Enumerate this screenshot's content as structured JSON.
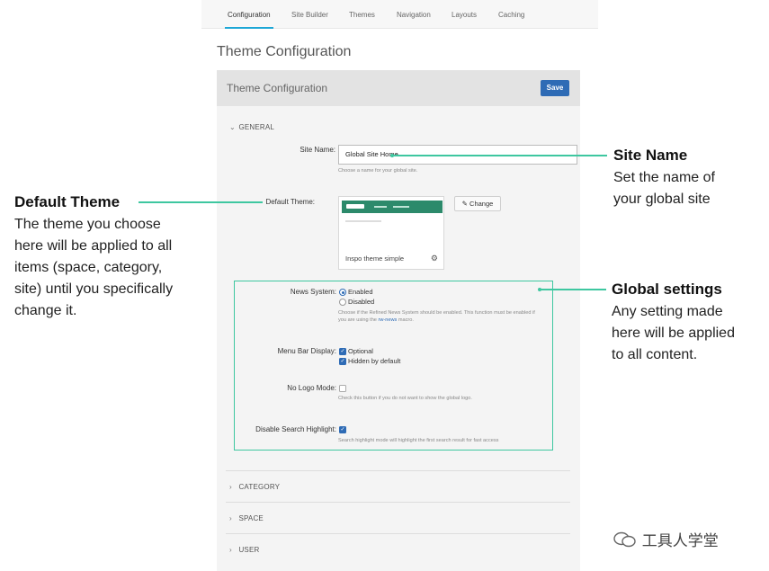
{
  "tabs": [
    {
      "label": "Configuration",
      "active": true
    },
    {
      "label": "Site Builder",
      "active": false
    },
    {
      "label": "Themes",
      "active": false
    },
    {
      "label": "Navigation",
      "active": false
    },
    {
      "label": "Layouts",
      "active": false
    },
    {
      "label": "Caching",
      "active": false
    }
  ],
  "page_title": "Theme Configuration",
  "panel": {
    "title": "Theme Configuration",
    "save_label": "Save"
  },
  "sections": {
    "general": "GENERAL",
    "category": "CATEGORY",
    "space": "SPACE",
    "user": "USER"
  },
  "site_name": {
    "label": "Site Name:",
    "value": "Global Site Home",
    "help": "Choose a name for your global site."
  },
  "default_theme": {
    "label": "Default Theme:",
    "theme_name": "Inspo theme simple",
    "change_label": "Change"
  },
  "news_system": {
    "label": "News System:",
    "options": [
      "Enabled",
      "Disabled"
    ],
    "selected": "Enabled",
    "help_line1": "Choose if the Refined News System should be enabled. This function must be enabled if",
    "help_line2_pre": "you are using the ",
    "help_code": "rw-news",
    "help_line2_post": " macro."
  },
  "menu_bar": {
    "label": "Menu Bar Display:",
    "options": [
      "Optional",
      "Hidden by default"
    ],
    "checked": [
      true,
      true
    ]
  },
  "no_logo": {
    "label": "No Logo Mode:",
    "checked": false,
    "help": "Check this button if you do not want to show the global logo."
  },
  "search_highlight": {
    "label": "Disable Search Highlight:",
    "checked": true,
    "help": "Search highlight mode will highlight the first search result for fast access"
  },
  "annotations": {
    "site_name": {
      "title": "Site Name",
      "lines": [
        "Set the name of",
        "your global site"
      ]
    },
    "default_theme": {
      "title": "Default Theme",
      "lines": [
        "The theme you choose",
        "here will be applied to all",
        "items (space, category,",
        "site) until you specifically",
        "change it."
      ]
    },
    "global_settings": {
      "title": "Global settings",
      "lines": [
        "Any setting made",
        "here will be applied",
        "to all content."
      ]
    }
  },
  "watermark": "工具人学堂",
  "colors": {
    "accent": "#3ec7a0",
    "primary": "#2e6bb5",
    "tab_underline": "#1ea7d6"
  }
}
